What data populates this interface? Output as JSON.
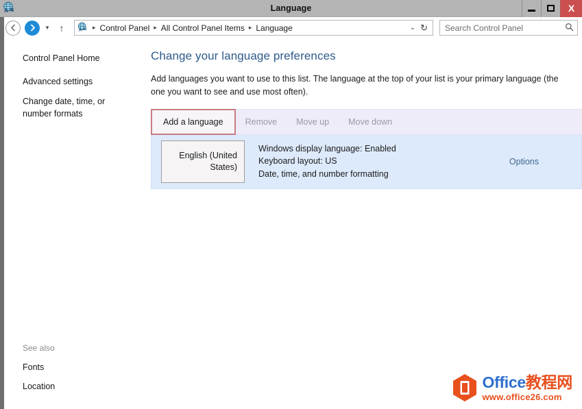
{
  "window": {
    "title": "Language",
    "icon": "language-globe-icon",
    "controls": {
      "minimize": "minimize-button",
      "maximize": "maximize-button",
      "close_label": "X"
    }
  },
  "navbar": {
    "back": "back-button",
    "forward": "forward-button",
    "recent_dropdown": "recent-pages-dropdown",
    "up": "up-one-level-button",
    "breadcrumbs": [
      "Control Panel",
      "All Control Panel Items",
      "Language"
    ],
    "separator": "▸",
    "address_chevron": "⌄",
    "refresh": "↻",
    "search": {
      "placeholder": "Search Control Panel",
      "value": "",
      "icon": "search-icon"
    }
  },
  "sidebar": {
    "home_label": "Control Panel Home",
    "items": [
      {
        "label": "Advanced settings"
      },
      {
        "label": "Change date, time, or number formats"
      }
    ],
    "see_also": {
      "heading": "See also",
      "items": [
        {
          "label": "Fonts"
        },
        {
          "label": "Location"
        }
      ]
    }
  },
  "main": {
    "title": "Change your language preferences",
    "description": "Add languages you want to use to this list. The language at the top of your list is your primary language (the one you want to see and use most often).",
    "toolbar": {
      "buttons": [
        {
          "label": "Add a language",
          "enabled": true,
          "highlighted": true
        },
        {
          "label": "Remove",
          "enabled": false
        },
        {
          "label": "Move up",
          "enabled": false
        },
        {
          "label": "Move down",
          "enabled": false
        }
      ]
    },
    "languages": [
      {
        "name": "English (United States)",
        "display_language": "Windows display language: Enabled",
        "keyboard_layout": "Keyboard layout: US",
        "formatting": "Date, time, and number formatting",
        "options_label": "Options"
      }
    ]
  },
  "watermark": {
    "brand_en": "Office",
    "brand_cn": "教程网",
    "url": "www.office26.com",
    "logo_color": "#e8501e",
    "text_color_en": "#2f6fd0",
    "text_color_cn": "#e8501e"
  },
  "colors": {
    "titlebar": "#b4b4b4",
    "close_button": "#cc4f4f",
    "toolbar_bg": "#edecf8",
    "list_bg": "#ddeafb",
    "highlight_border": "#c77b82",
    "heading": "#2f5a8b",
    "link": "#40688f",
    "forward_button": "#1e8bd6"
  }
}
